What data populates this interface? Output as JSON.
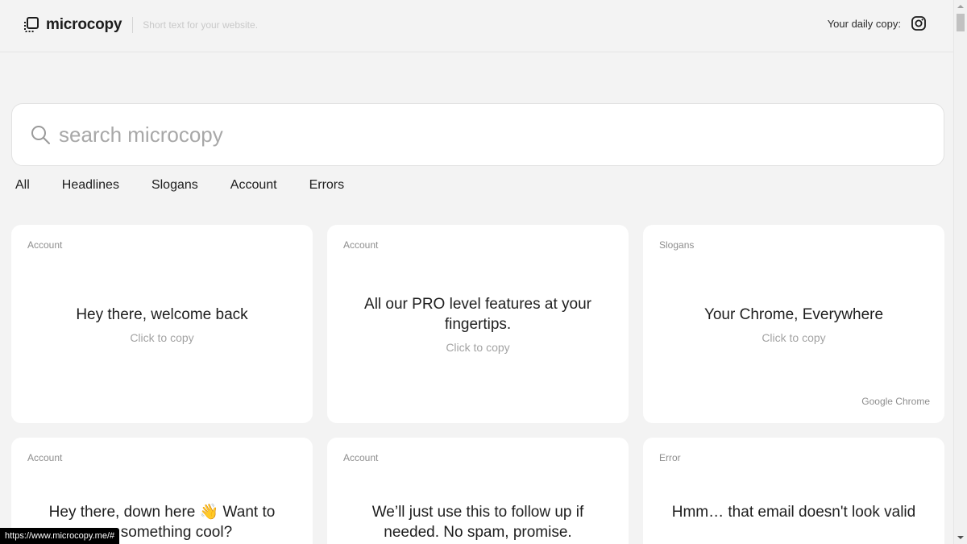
{
  "header": {
    "brand_name": "microcopy",
    "tagline": "Short text for your website.",
    "daily_label": "Your daily copy:",
    "icons": {
      "logo": "copy-icon",
      "instagram": "instagram-icon"
    }
  },
  "search": {
    "placeholder": "search microcopy",
    "value": "",
    "icon": "search-icon"
  },
  "tabs": [
    "All",
    "Headlines",
    "Slogans",
    "Account",
    "Errors"
  ],
  "cards": [
    {
      "category": "Account",
      "text": "Hey there, welcome back",
      "copy_label": "Click to copy",
      "source": ""
    },
    {
      "category": "Account",
      "text": "All our PRO level features at your fingertips.",
      "copy_label": "Click to copy",
      "source": ""
    },
    {
      "category": "Slogans",
      "text": "Your Chrome, Everywhere",
      "copy_label": "Click to copy",
      "source": "Google Chrome"
    },
    {
      "category": "Account",
      "text": "Hey there, down here 👋 Want to see something cool?",
      "copy_label": "",
      "source": ""
    },
    {
      "category": "Account",
      "text": "We’ll just use this to follow up if needed. No spam, promise.",
      "copy_label": "",
      "source": ""
    },
    {
      "category": "Error",
      "text": "Hmm… that email doesn't look valid",
      "copy_label": "",
      "source": ""
    }
  ],
  "status_bar": {
    "url": "https://www.microcopy.me/#"
  },
  "colors": {
    "background": "#f3f3f3",
    "card": "#ffffff",
    "muted": "#8e8e8e"
  }
}
